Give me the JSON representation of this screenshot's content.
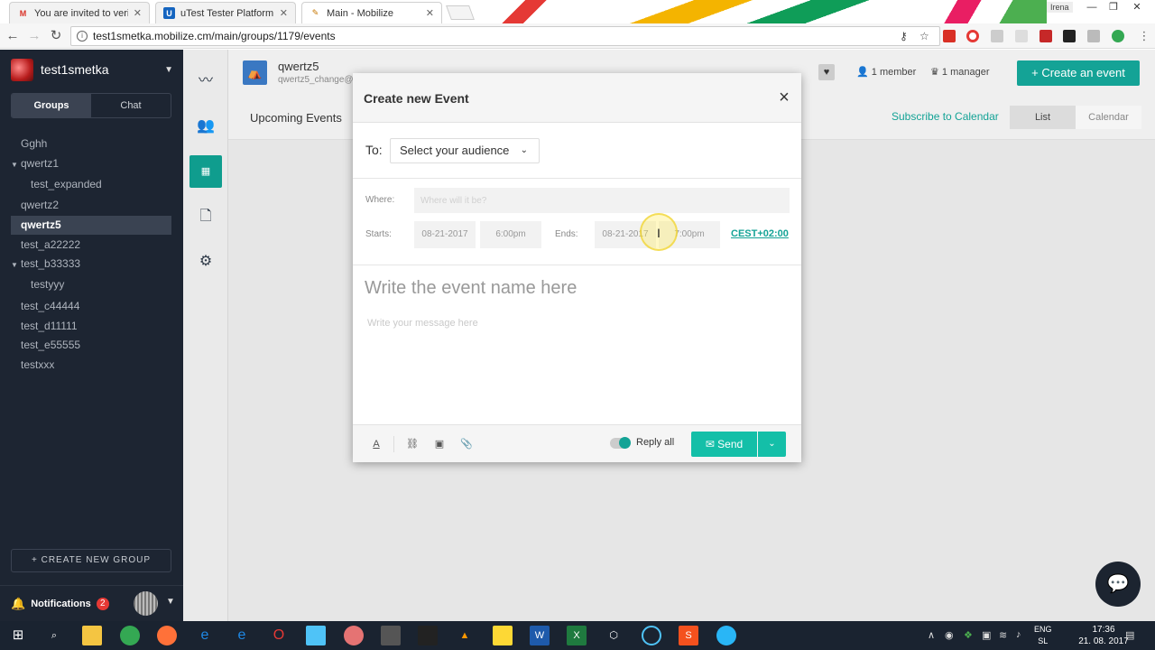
{
  "browser": {
    "tabs": [
      {
        "title": "You are invited to verify t",
        "favicon": "M",
        "color": "#d93025"
      },
      {
        "title": "uTest Tester Platform",
        "favicon": "U",
        "color": "#1565c0"
      },
      {
        "title": "Main - Mobilize",
        "favicon": "✎",
        "color": "#c77700"
      }
    ],
    "user": "Irena",
    "url": "test1smetka.mobilize.cm/main/groups/1179/events"
  },
  "sidebar": {
    "org_name": "test1smetka",
    "segments": [
      "Groups",
      "Chat"
    ],
    "groups": [
      {
        "label": "Gghh"
      },
      {
        "label": "qwertz1"
      },
      {
        "label": "test_expanded"
      },
      {
        "label": "qwertz2"
      },
      {
        "label": "qwertz5"
      },
      {
        "label": "test_a22222"
      },
      {
        "label": "test_b33333"
      },
      {
        "label": "testyyy"
      },
      {
        "label": "test_c44444"
      },
      {
        "label": "test_d11111"
      },
      {
        "label": "test_e55555"
      },
      {
        "label": "testxxx"
      }
    ],
    "create_group": "+ CREATE NEW GROUP",
    "notifications_label": "Notifications",
    "notifications_count": "2"
  },
  "header": {
    "group_name": "qwertz5",
    "group_sub": "qwertz5_change@",
    "members": "1 member",
    "managers": "1 manager",
    "create_event": "Create an event",
    "upcoming": "Upcoming Events",
    "subscribe": "Subscribe to Calendar",
    "views": [
      "List",
      "Calendar"
    ]
  },
  "modal": {
    "title": "Create new Event",
    "to_label": "To:",
    "audience": "Select your audience",
    "where_label": "Where:",
    "where_placeholder": "Where will it be?",
    "starts_label": "Starts:",
    "start_date": "08-21-2017",
    "start_time": "6:00pm",
    "ends_label": "Ends:",
    "end_date": "08-21-2017",
    "end_time": "7:00pm",
    "timezone": "CEST+02:00",
    "event_name_placeholder": "Write the event name here",
    "message_placeholder": "Write your message here",
    "reply_all": "Reply all",
    "send": "Send"
  },
  "taskbar": {
    "lang_1": "ENG",
    "lang_2": "SL",
    "time": "17:36",
    "date": "21. 08. 2017"
  },
  "colors": {
    "accent": "#14a396",
    "sidebar_bg": "#1d2532"
  }
}
